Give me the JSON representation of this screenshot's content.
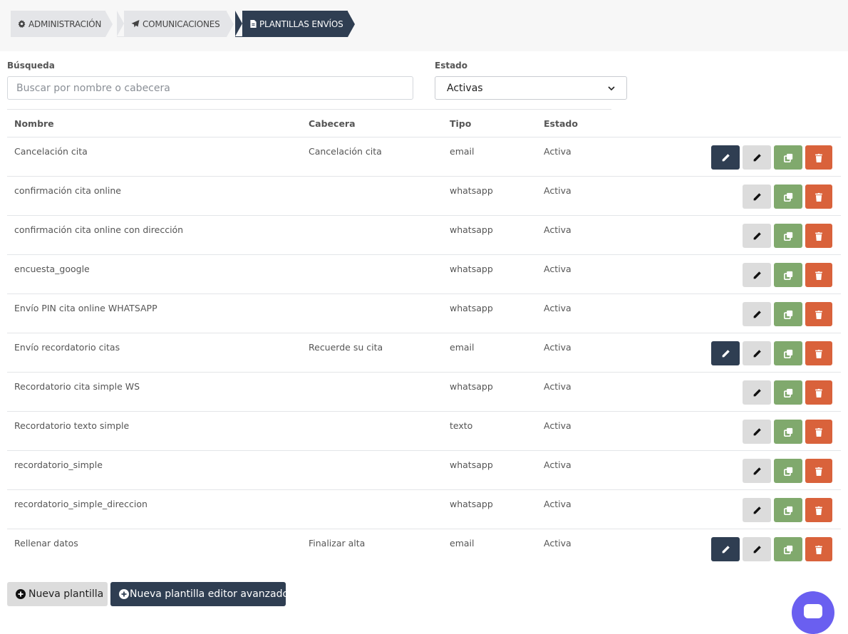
{
  "breadcrumb": {
    "items": [
      {
        "label": "ADMINISTRACIÓN",
        "icon": "gear-icon"
      },
      {
        "label": "COMUNICACIONES",
        "icon": "paper-plane-icon"
      },
      {
        "label": "PLANTILLAS ENVÍOS",
        "icon": "file-icon"
      }
    ]
  },
  "search": {
    "label": "Búsqueda",
    "placeholder": "Buscar por nombre o cabecera",
    "value": ""
  },
  "status_filter": {
    "label": "Estado",
    "value": "Activas"
  },
  "table": {
    "headers": {
      "name": "Nombre",
      "header": "Cabecera",
      "type": "Tipo",
      "status": "Estado"
    },
    "rows": [
      {
        "name": "Cancelación cita",
        "header": "Cancelación cita",
        "type": "email",
        "status": "Activa",
        "advanced_edit": true
      },
      {
        "name": "confirmación cita online",
        "header": "",
        "type": "whatsapp",
        "status": "Activa",
        "advanced_edit": false
      },
      {
        "name": "confirmación cita online con dirección",
        "header": "",
        "type": "whatsapp",
        "status": "Activa",
        "advanced_edit": false
      },
      {
        "name": "encuesta_google",
        "header": "",
        "type": "whatsapp",
        "status": "Activa",
        "advanced_edit": false
      },
      {
        "name": "Envío PIN cita online WHATSAPP",
        "header": "",
        "type": "whatsapp",
        "status": "Activa",
        "advanced_edit": false
      },
      {
        "name": "Envío recordatorio citas",
        "header": "Recuerde su cita",
        "type": "email",
        "status": "Activa",
        "advanced_edit": true
      },
      {
        "name": "Recordatorio cita simple WS",
        "header": "",
        "type": "whatsapp",
        "status": "Activa",
        "advanced_edit": false
      },
      {
        "name": "Recordatorio texto simple",
        "header": "",
        "type": "texto",
        "status": "Activa",
        "advanced_edit": false
      },
      {
        "name": "recordatorio_simple",
        "header": "",
        "type": "whatsapp",
        "status": "Activa",
        "advanced_edit": false
      },
      {
        "name": "recordatorio_simple_direccion",
        "header": "",
        "type": "whatsapp",
        "status": "Activa",
        "advanced_edit": false
      },
      {
        "name": "Rellenar datos",
        "header": "Finalizar alta",
        "type": "email",
        "status": "Activa",
        "advanced_edit": true
      }
    ]
  },
  "footer": {
    "new_template_label": "Nueva plantilla",
    "new_advanced_template_label": "Nueva plantilla editor avanzado"
  },
  "colors": {
    "primary_dark": "#2f3e52",
    "copy_green": "#80a96d",
    "delete_red": "#d9623b",
    "chat_purple": "#6a5ff0"
  }
}
